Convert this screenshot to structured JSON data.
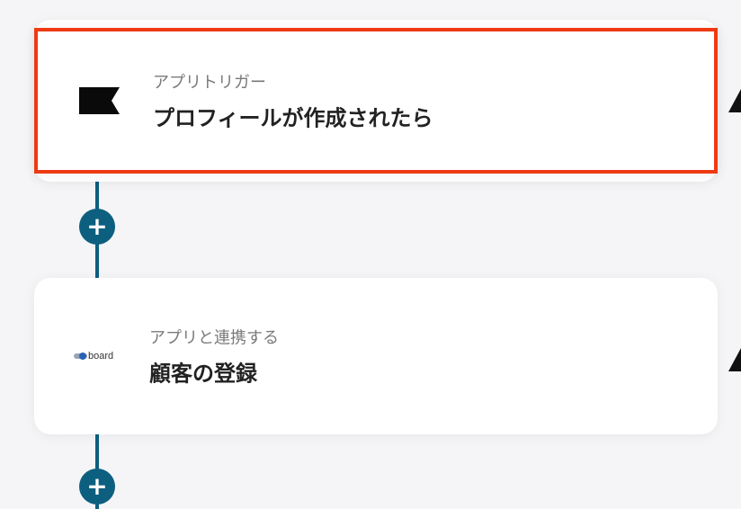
{
  "steps": [
    {
      "category": "アプリトリガー",
      "title": "プロフィールが作成されたら",
      "icon": "flag-icon",
      "selected": true
    },
    {
      "category": "アプリと連携する",
      "title": "顧客の登録",
      "icon": "board-logo",
      "app_name": "board"
    }
  ],
  "add_step_symbol": "+",
  "colors": {
    "connector": "#0d5f80",
    "selected_border": "#ee3a12",
    "background": "#f5f5f7"
  }
}
